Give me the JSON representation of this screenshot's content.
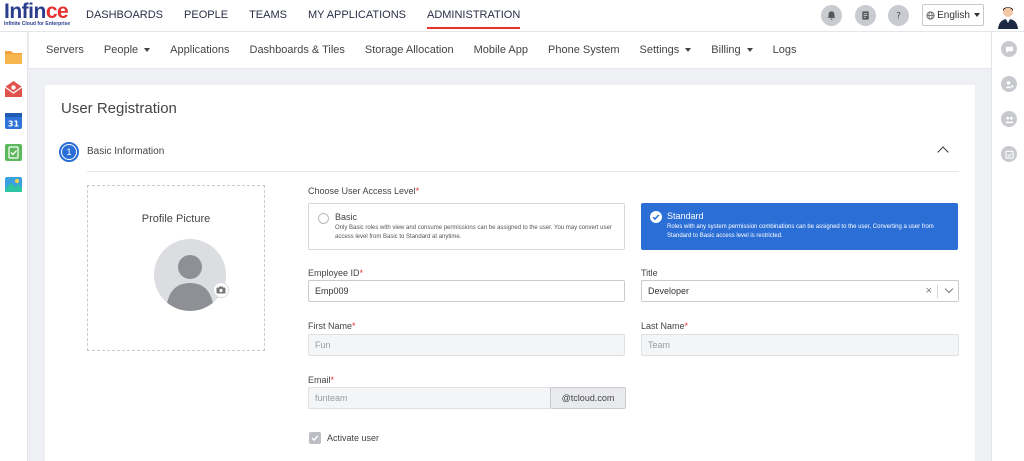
{
  "brand": {
    "logo_prefix": "Infin",
    "logo_accent": "ce",
    "tagline": "Infinite Cloud for Enterprise",
    "primary_color": "#2b3e8c",
    "accent_color": "#e5322d",
    "selection_color": "#2b6fd6"
  },
  "topnav": {
    "items": [
      {
        "label": "DASHBOARDS"
      },
      {
        "label": "PEOPLE"
      },
      {
        "label": "TEAMS"
      },
      {
        "label": "MY APPLICATIONS"
      },
      {
        "label": "ADMINISTRATION",
        "active": true
      }
    ],
    "icons": [
      "bell-icon",
      "report-icon",
      "help-icon"
    ],
    "language": "English"
  },
  "left_apps": [
    "folder-app-icon",
    "mail-app-icon",
    "calendar-app-icon",
    "tasks-app-icon",
    "photos-app-icon"
  ],
  "calendar_day": "31",
  "right_rail": [
    "chat-icon",
    "contact-icon",
    "group-icon",
    "calendar-check-icon"
  ],
  "subnav": {
    "items": [
      {
        "label": "Servers"
      },
      {
        "label": "People",
        "dropdown": true
      },
      {
        "label": "Applications"
      },
      {
        "label": "Dashboards & Tiles"
      },
      {
        "label": "Storage Allocation"
      },
      {
        "label": "Mobile App"
      },
      {
        "label": "Phone System"
      },
      {
        "label": "Settings",
        "dropdown": true
      },
      {
        "label": "Billing",
        "dropdown": true
      },
      {
        "label": "Logs"
      }
    ]
  },
  "page": {
    "title": "User Registration",
    "section": {
      "number": "1",
      "label": "Basic Information"
    }
  },
  "profile": {
    "label": "Profile Picture"
  },
  "access": {
    "label": "Choose User Access Level",
    "basic": {
      "title": "Basic",
      "desc": "Only Basic roles with view and consume permissions can be assigned to the user. You may convert user access level from Basic to Standard at anytime."
    },
    "standard": {
      "title": "Standard",
      "desc": "Roles with any system permission combinations can be assigned to the user, Converting a user from Standard to Basic access level is restricted.",
      "selected": true
    }
  },
  "form": {
    "employee_id": {
      "label": "Employee ID",
      "value": "Emp009"
    },
    "title": {
      "label": "Title",
      "value": "Developer"
    },
    "first_name": {
      "label": "First Name",
      "value": "Fun"
    },
    "last_name": {
      "label": "Last Name",
      "value": "Team"
    },
    "email": {
      "label": "Email",
      "value": "funteam",
      "domain": "@tcloud.com"
    },
    "activate": {
      "label": "Activate user",
      "checked": true
    }
  }
}
